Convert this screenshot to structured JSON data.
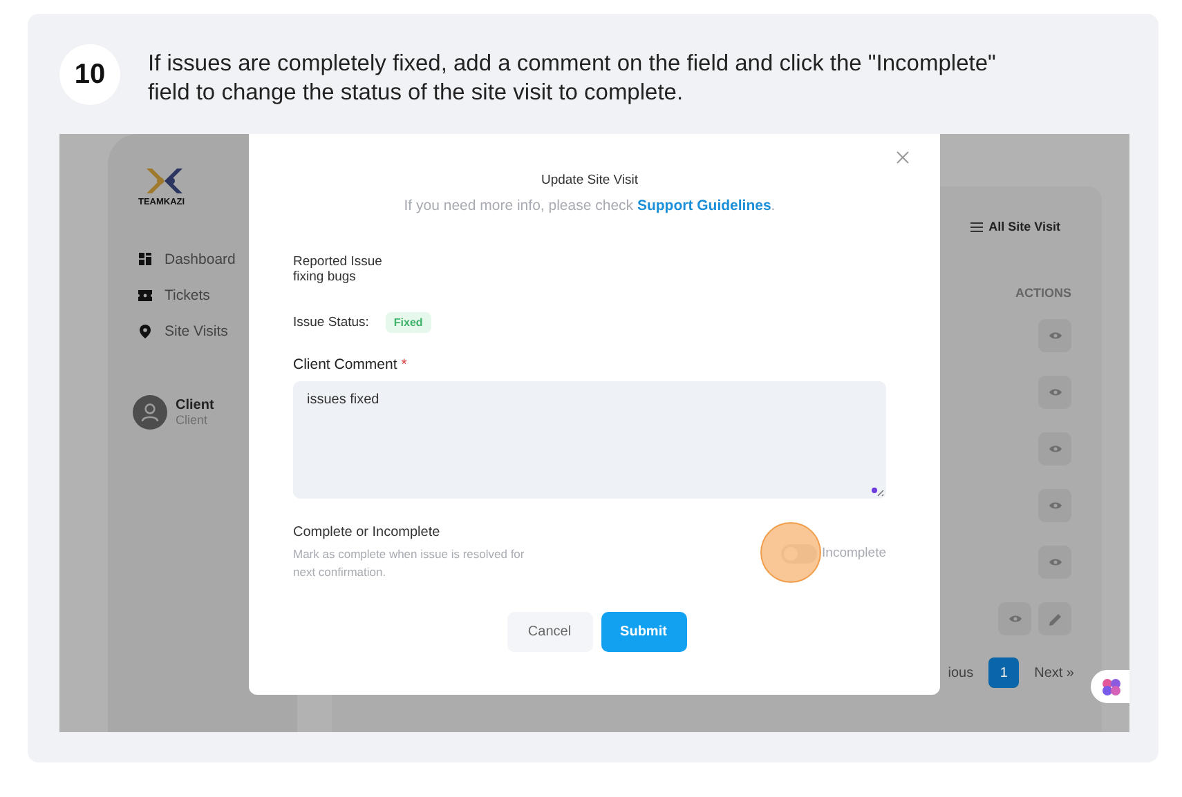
{
  "step": {
    "number": "10",
    "instruction": "If issues are completely fixed, add a comment on the field and click the \"Incomplete\" field to change the status of the site visit to complete."
  },
  "screenshot": {
    "sidebar": {
      "logo_text": "TEAMKAZI",
      "items": [
        {
          "kind": "dashboard",
          "label": "Dashboard"
        },
        {
          "kind": "tickets",
          "label": "Tickets"
        },
        {
          "kind": "location",
          "label": "Site Visits"
        }
      ],
      "user": {
        "name": "Client",
        "role": "Client"
      }
    },
    "main": {
      "menu_button": "All Site Visit",
      "column_header": "ACTIONS",
      "rows": [
        {
          "actions": [
            {
              "kind": "view"
            }
          ]
        },
        {
          "actions": [
            {
              "kind": "view"
            }
          ]
        },
        {
          "actions": [
            {
              "kind": "view"
            }
          ]
        },
        {
          "actions": [
            {
              "kind": "view"
            }
          ]
        },
        {
          "actions": [
            {
              "kind": "view"
            }
          ]
        },
        {
          "actions": [
            {
              "kind": "view"
            },
            {
              "kind": "edit"
            }
          ]
        }
      ],
      "pagination": {
        "previous": "ious",
        "pages": [
          {
            "label": "1",
            "selected": true
          }
        ],
        "next": "Next »"
      }
    },
    "modal": {
      "title": "Update Site Visit",
      "help_text": "If you need more info, please check ",
      "help_link": "Support Guidelines",
      "help_end": ".",
      "reported_issue_label": "Reported Issue",
      "reported_issue": "fixing bugs",
      "status_label": "Issue Status:",
      "status": "Fixed",
      "comment_label": "Client Comment",
      "required_mark": "*",
      "comment": "issues fixed",
      "toggle_label": "Complete or Incomplete",
      "toggle_description": "Mark as complete when issue is resolved for next confirmation.",
      "toggle_on": false,
      "toggle_text": "Incomplete",
      "buttons": [
        {
          "kind": "secondary",
          "label": "Cancel"
        },
        {
          "kind": "primary",
          "label": "Submit"
        }
      ]
    }
  }
}
